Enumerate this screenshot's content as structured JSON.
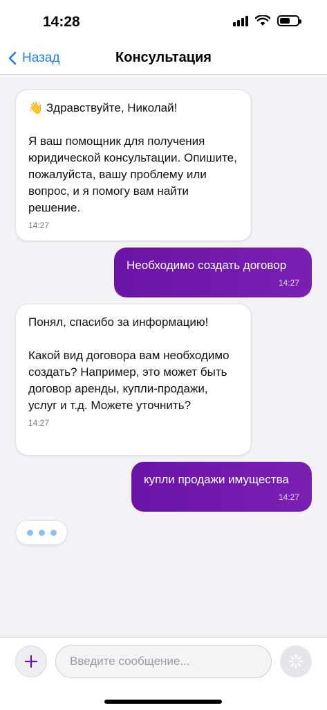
{
  "status_bar": {
    "time": "14:28"
  },
  "navbar": {
    "back_label": "Назад",
    "title": "Консультация"
  },
  "messages": [
    {
      "from": "assistant",
      "text": "👋 Здравствуйте, Николай!\n\nЯ ваш помощник для получения юридической консультации. Опишите, пожалуйста, вашу проблему или вопрос, и я помогу вам найти решение.",
      "time": "14:27"
    },
    {
      "from": "user",
      "text": "Необходимо создать договор",
      "time": "14:27"
    },
    {
      "from": "assistant",
      "text": "Понял, спасибо за информацию!\n\nКакой вид договора вам необходимо создать? Например, это может быть договор аренды, купли-продажи, услуг и т.д. Можете уточнить?",
      "time": "14:27"
    },
    {
      "from": "user",
      "text": "купли продажи имущества",
      "time": "14:27"
    }
  ],
  "input": {
    "placeholder": "Введите сообщение...",
    "value": ""
  },
  "colors": {
    "accent": "#1b7cf5",
    "user_bubble": "#6a14a8",
    "typing_dot": "#8cc0f5"
  }
}
